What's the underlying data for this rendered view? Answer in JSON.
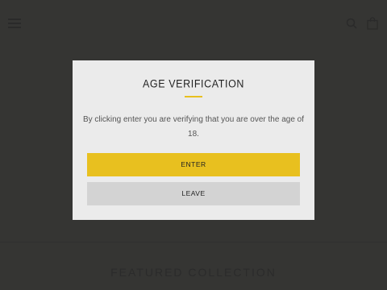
{
  "background": {
    "footer_text": "FEATURED COLLECTION"
  },
  "modal": {
    "title": "AGE VERIFICATION",
    "message": "By clicking enter you are verifying that you are over the age of 18.",
    "enter_label": "ENTER",
    "leave_label": "LEAVE"
  },
  "colors": {
    "accent": "#e8c01f",
    "modal_bg": "#ebebeb",
    "secondary_button": "#d3d3d3",
    "overlay": "#383838"
  },
  "icons": {
    "menu": "hamburger-icon",
    "search": "search-icon",
    "cart": "bag-icon"
  }
}
